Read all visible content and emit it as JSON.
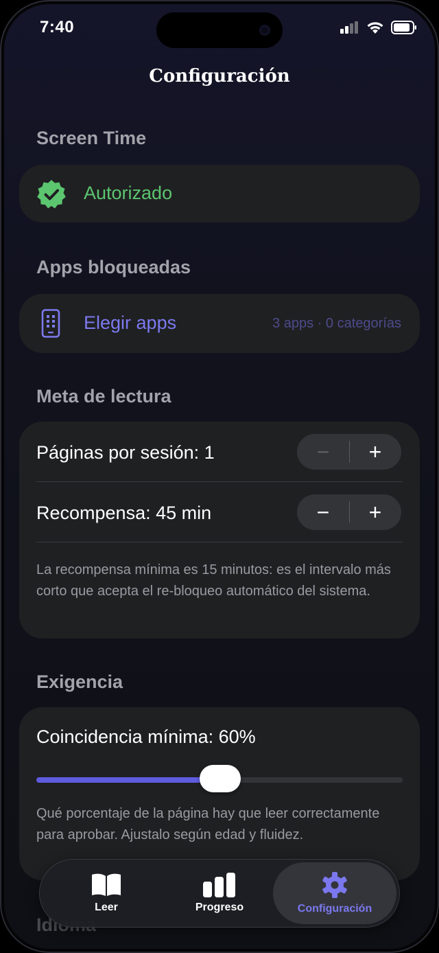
{
  "status_bar": {
    "time": "7:40"
  },
  "nav": {
    "title": "Configuración"
  },
  "screen_time": {
    "section_title": "Screen Time",
    "status_label": "Autorizado",
    "status_icon": "verified-check-badge",
    "status_color": "#5cc56f"
  },
  "blocked_apps": {
    "section_title": "Apps bloqueadas",
    "action_label": "Elegir apps",
    "action_icon": "phone-apps-icon",
    "summary": "3 apps · 0 categorías",
    "accent_color": "#7d7af0"
  },
  "reading_goal": {
    "section_title": "Meta de lectura",
    "pages_label": "Páginas por sesión: 1",
    "reward_label": "Recompensa: 45 min",
    "note": "La recompensa mínima es 15 minutos: es el intervalo más corto que acepta el re-bloqueo automático del sistema.",
    "minus_symbol": "−",
    "plus_symbol": "+"
  },
  "strictness": {
    "section_title": "Exigencia",
    "match_label": "Coincidencia mínima: 60%",
    "slider_value_percent": 60,
    "note": "Qué porcentaje de la página hay que leer correctamente para aprobar. Ajustalo según edad y fluidez."
  },
  "language": {
    "section_title": "Idioma"
  },
  "tabs": [
    {
      "label": "Leer",
      "icon": "book-icon"
    },
    {
      "label": "Progreso",
      "icon": "bar-chart-icon"
    },
    {
      "label": "Configuración",
      "icon": "gear-icon",
      "active": true
    }
  ]
}
